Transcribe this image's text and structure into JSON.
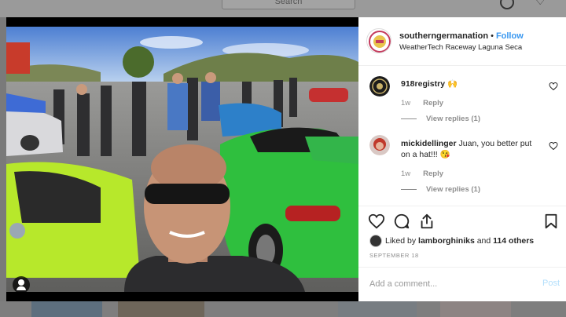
{
  "background": {
    "search_placeholder": "Search"
  },
  "post": {
    "username": "southerngermanation",
    "separator": "•",
    "follow_label": "Follow",
    "location": "WeatherTech Raceway Laguna Seca",
    "comments": [
      {
        "username": "918registry",
        "text": "🙌",
        "time": "1w",
        "reply_label": "Reply",
        "view_replies": "View replies (1)"
      },
      {
        "username": "mickidellinger",
        "text": "Juan, you better put on a hat!!! 😘",
        "time": "1w",
        "reply_label": "Reply",
        "view_replies": "View replies (1)"
      }
    ],
    "liked_by_prefix": "Liked by",
    "liked_by_user": "lamborghiniks",
    "liked_by_and": "and",
    "liked_by_others": "114 others",
    "date": "SEPTEMBER 18",
    "add_comment_placeholder": "Add a comment...",
    "post_label": "Post"
  },
  "icons": [
    "search-icon",
    "compass-icon",
    "heart-icon",
    "user-tag-icon",
    "like-heart-icon",
    "comment-icon",
    "share-icon",
    "bookmark-icon"
  ],
  "colors": {
    "link_blue": "#3897f0",
    "text_dark": "#262626",
    "text_muted": "#8e8e8e",
    "post_disabled": "#b2dffc"
  }
}
